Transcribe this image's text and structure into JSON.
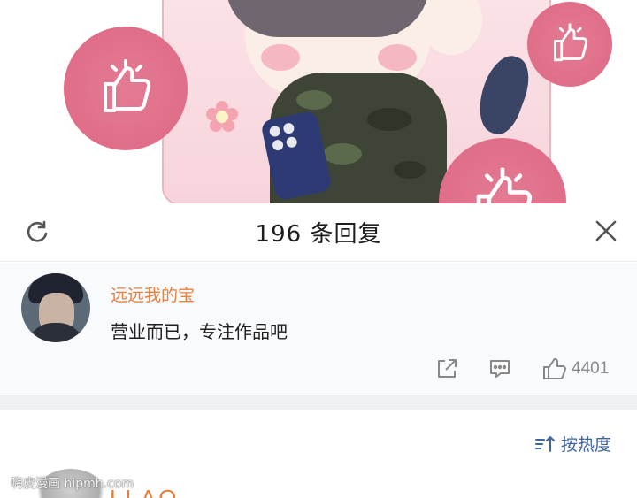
{
  "header": {
    "title": "196 条回复"
  },
  "comment": {
    "username": "远远我的宝",
    "text": "营业而已，专注作品吧",
    "like_count": "4401"
  },
  "sort": {
    "label": "按热度"
  },
  "watermark": "嗨皮漫画 hipmh.com",
  "next_comment": {
    "username_partial": "LLAQ"
  },
  "colors": {
    "username": "#e8803f",
    "sort_link": "#3f64a3",
    "thumb_badge": "#e06e89"
  },
  "icons": [
    "refresh-icon",
    "close-icon",
    "share-icon",
    "reply-icon",
    "like-icon",
    "sort-icon",
    "thumbs-up-icon"
  ]
}
